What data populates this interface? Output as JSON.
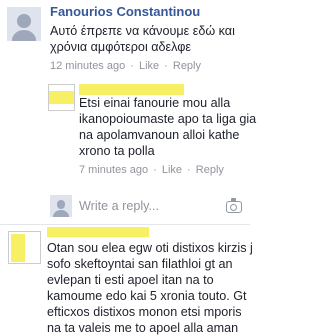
{
  "comments": [
    {
      "author": "Fanourios Constantinou",
      "lines": [
        "Αυτό έπρεπε να κάνουμε εδώ και",
        "χρόνια αμφότεροι αδελφε"
      ],
      "timestamp": "12 minutes ago",
      "like": "Like",
      "reply": "Reply"
    },
    {
      "lines": [
        "Etsi einai fanourie mou alla",
        "ikanopoioumaste apo ta liga gia",
        "na apolamvanoun alloi kathe",
        "xrono ta polla"
      ],
      "timestamp": "7 minutes ago",
      "like": "Like",
      "reply": "Reply"
    },
    {
      "lines": [
        "Otan sou elea egw oti distixos kirzis j",
        "sofo skeftoyntai san filathloi gt an",
        "evlepan ti esti apoel itan na to",
        "kamoume edo kai 5 xronia touto. Gt",
        "efticxos distixos monon etsi mporis",
        "na ta valeis me to apoel alla aman"
      ]
    }
  ],
  "reply_box": {
    "placeholder": "Write a reply..."
  }
}
